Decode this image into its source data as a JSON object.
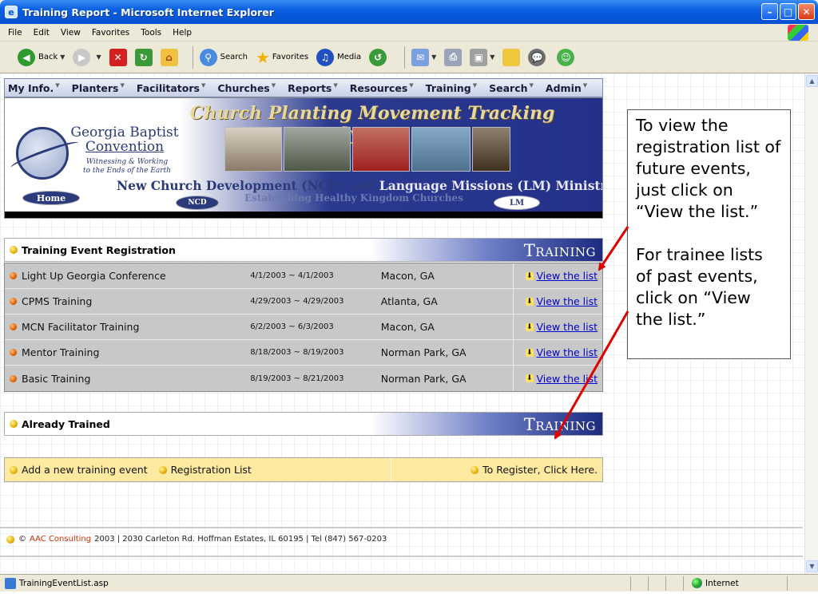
{
  "window": {
    "title": "Training Report - Microsoft Internet Explorer"
  },
  "menubar": [
    "File",
    "Edit",
    "View",
    "Favorites",
    "Tools",
    "Help"
  ],
  "toolbar": {
    "back": "Back",
    "search": "Search",
    "favorites": "Favorites",
    "media": "Media"
  },
  "sitenav": [
    "My Info.",
    "Planters",
    "Facilitators",
    "Churches",
    "Reports",
    "Resources",
    "Training",
    "Search",
    "Admin"
  ],
  "banner": {
    "title": "Church Planting Movement Tracking System",
    "org_line1": "Georgia Baptist",
    "org_line2": "Convention",
    "tagline1": "Witnessing & Working",
    "tagline2": "to the Ends of the Earth",
    "ministries_a": "New Church Development (NCD) and ",
    "ministries_b": "Language Missions (LM) Ministries",
    "establishing": "Establishing Healthy Kingdom Churches",
    "home": "Home",
    "ncd": "NCD",
    "lm": "LM"
  },
  "registration": {
    "title": "Training Event Registration",
    "badge": "Training",
    "link_label": "View the list",
    "events": [
      {
        "name": "Light Up Georgia Conference",
        "dates": "4/1/2003 ~ 4/1/2003",
        "location": "Macon, GA"
      },
      {
        "name": "CPMS Training",
        "dates": "4/29/2003 ~ 4/29/2003",
        "location": "Atlanta, GA"
      },
      {
        "name": "MCN Facilitator Training",
        "dates": "6/2/2003 ~ 6/3/2003",
        "location": "Macon, GA"
      },
      {
        "name": "Mentor Training",
        "dates": "8/18/2003 ~ 8/19/2003",
        "location": "Norman Park, GA"
      },
      {
        "name": "Basic Training",
        "dates": "8/19/2003 ~ 8/21/2003",
        "location": "Norman Park, GA"
      }
    ]
  },
  "trained": {
    "title": "Already Trained",
    "badge": "Training"
  },
  "actions": {
    "add": "Add a new training event",
    "registration_list": "Registration List",
    "register": "To Register, Click Here."
  },
  "footer": {
    "company": "AAC Consulting",
    "text": "2003 | 2030 Carleton Rd. Hoffman Estates, IL 60195 | Tel  (847) 567-0203"
  },
  "callout": {
    "p1": "To view the registration list of future events, just click on “View the list.”",
    "p2": "For trainee lists of past events, click on “View the list.”"
  },
  "statusbar": {
    "url": "TrainingEventList.asp",
    "zone": "Internet"
  },
  "colors": {
    "titlebar": "#0a5fe0",
    "nav_blue": "#243089",
    "row_gray": "#c8c8c8",
    "action_yellow": "#fde9a0",
    "arrow_red": "#e00000",
    "link_blue": "#0000cc"
  }
}
